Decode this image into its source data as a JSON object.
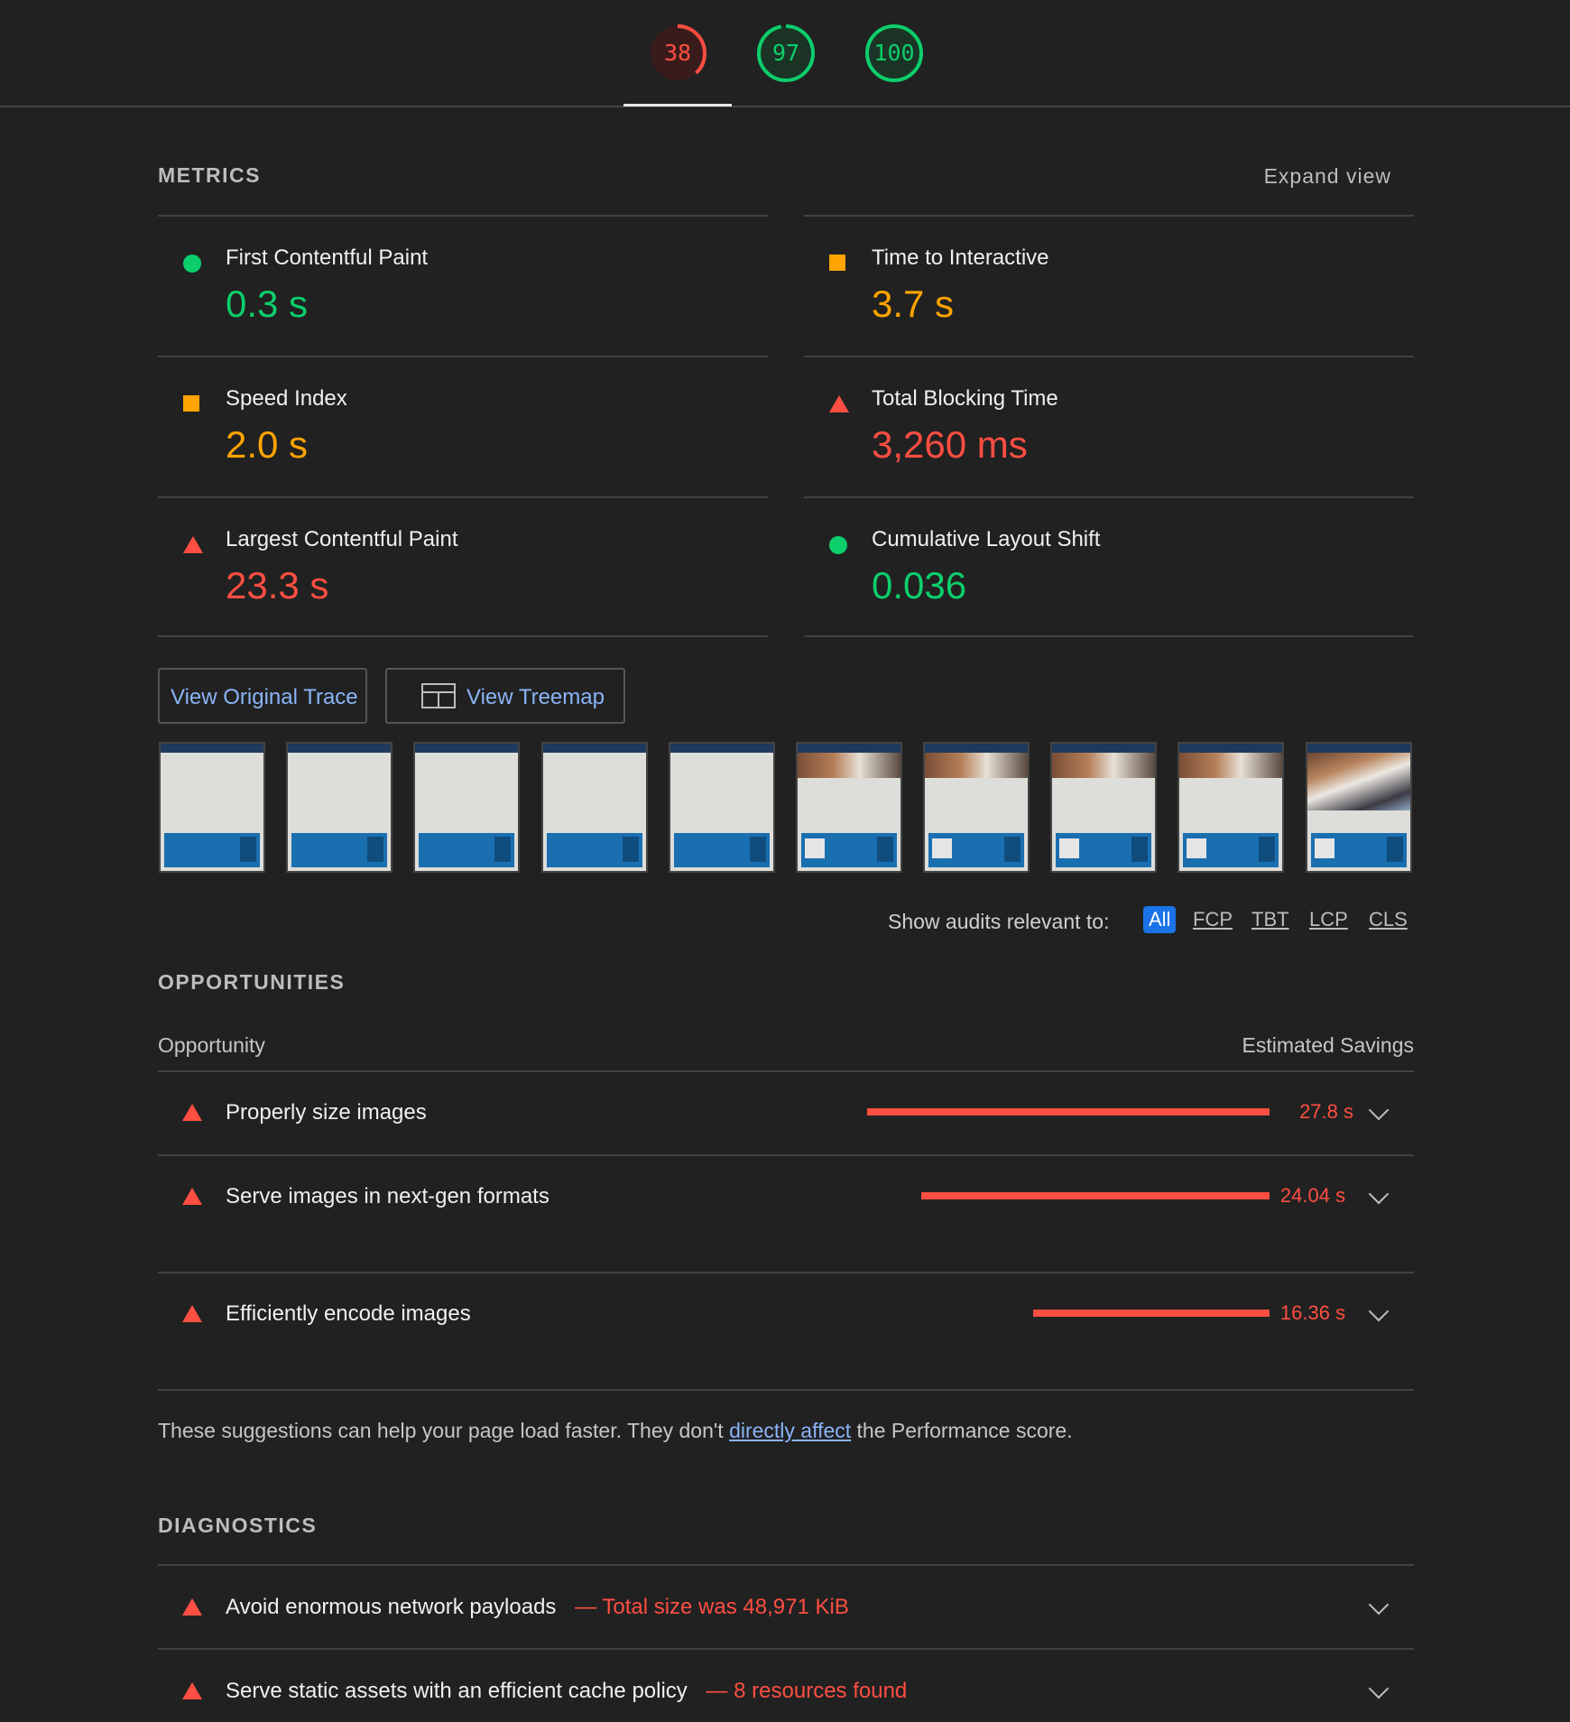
{
  "gauges": [
    {
      "score": "38",
      "status": "red",
      "fraction": 0.38
    },
    {
      "score": "97",
      "status": "green",
      "fraction": 0.97
    },
    {
      "score": "100",
      "status": "green",
      "fraction": 1.0
    }
  ],
  "colors": {
    "green": "#0cce6b",
    "orange": "#ffa400",
    "red": "#ff4e42",
    "link": "#8ab4f8",
    "background": "#212121"
  },
  "metrics_section": {
    "title": "METRICS",
    "expand_label": "Expand view",
    "items": [
      {
        "label": "First Contentful Paint",
        "value": "0.3 s",
        "status": "pass",
        "icon": "green-circle-icon"
      },
      {
        "label": "Time to Interactive",
        "value": "3.7 s",
        "status": "average",
        "icon": "orange-square-icon"
      },
      {
        "label": "Speed Index",
        "value": "2.0 s",
        "status": "average",
        "icon": "orange-square-icon"
      },
      {
        "label": "Total Blocking Time",
        "value": "3,260 ms",
        "status": "fail",
        "icon": "red-triangle-icon"
      },
      {
        "label": "Largest Contentful Paint",
        "value": "23.3 s",
        "status": "fail",
        "icon": "red-triangle-icon"
      },
      {
        "label": "Cumulative Layout Shift",
        "value": "0.036",
        "status": "pass",
        "icon": "green-circle-icon"
      }
    ]
  },
  "buttons": {
    "view_trace": "View Original Trace",
    "view_treemap": "View Treemap"
  },
  "filmstrip": {
    "frame_count": 10
  },
  "audit_filter": {
    "label": "Show audits relevant to:",
    "options": [
      "All",
      "FCP",
      "TBT",
      "LCP",
      "CLS"
    ],
    "selected": "All"
  },
  "opportunities": {
    "title": "OPPORTUNITIES",
    "col_left": "Opportunity",
    "col_right": "Estimated Savings",
    "items": [
      {
        "title": "Properly size images",
        "savings": "27.8 s",
        "savings_seconds": 27.8
      },
      {
        "title": "Serve images in next-gen formats",
        "savings": "24.04 s",
        "savings_seconds": 24.04
      },
      {
        "title": "Efficiently encode images",
        "savings": "16.36 s",
        "savings_seconds": 16.36
      }
    ],
    "note_before": "These suggestions can help your page load faster. They don't ",
    "note_link": "directly affect",
    "note_after": " the Performance score."
  },
  "diagnostics": {
    "title": "DIAGNOSTICS",
    "items": [
      {
        "title": "Avoid enormous network payloads",
        "detail": "— Total size was 48,971 KiB"
      },
      {
        "title": "Serve static assets with an efficient cache policy",
        "detail": "— 8 resources found"
      }
    ]
  }
}
